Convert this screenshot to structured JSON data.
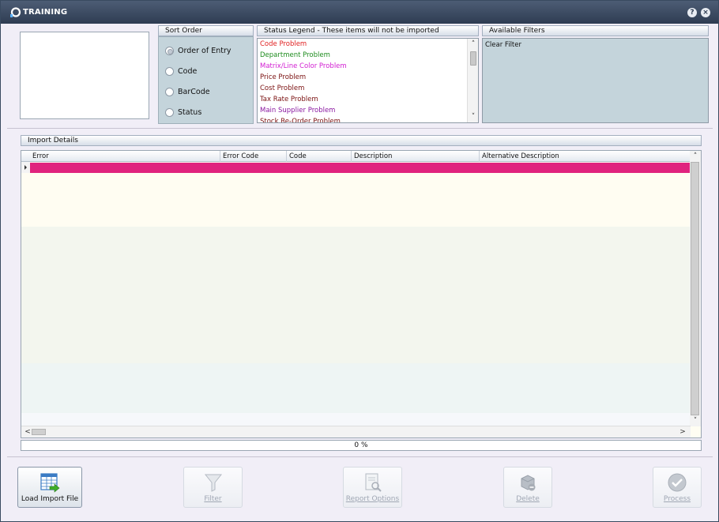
{
  "window": {
    "title": "TRAINING",
    "help_label": "?",
    "close_label": "×"
  },
  "sort_order": {
    "header": "Sort Order",
    "options": [
      {
        "label": "Order of Entry",
        "selected": true
      },
      {
        "label": "Code",
        "selected": false
      },
      {
        "label": "BarCode",
        "selected": false
      },
      {
        "label": "Status",
        "selected": false
      }
    ]
  },
  "status_legend": {
    "header": "Status Legend - These items will not be imported",
    "items": [
      {
        "label": "Code Problem",
        "color": "#e02020"
      },
      {
        "label": "Department Problem",
        "color": "#1e8c1e"
      },
      {
        "label": "Matrix/Line Color Problem",
        "color": "#d21ed2"
      },
      {
        "label": "Price Problem",
        "color": "#7a1010"
      },
      {
        "label": "Cost Problem",
        "color": "#7a1010"
      },
      {
        "label": "Tax Rate Problem",
        "color": "#7a1010"
      },
      {
        "label": "Main Supplier Problem",
        "color": "#8a18a0"
      },
      {
        "label": "Stock Re-Order Problem",
        "color": "#7a1010"
      }
    ]
  },
  "available_filters": {
    "header": "Available Filters",
    "items": [
      "Clear Filter"
    ]
  },
  "import_details": {
    "header": "Import Details",
    "columns": [
      "Error",
      "Error Code",
      "Code",
      "Description",
      "Alternative Description"
    ],
    "selected_row_color": "#e0237e"
  },
  "progress": {
    "text": "0 %"
  },
  "toolbar": {
    "load": {
      "label": "Load Import File",
      "enabled": true
    },
    "filter": {
      "label": "Filter",
      "enabled": false
    },
    "report": {
      "label": "Report Options",
      "enabled": false
    },
    "delete": {
      "label": "Delete",
      "enabled": false
    },
    "process": {
      "label": "Process",
      "enabled": false
    }
  }
}
